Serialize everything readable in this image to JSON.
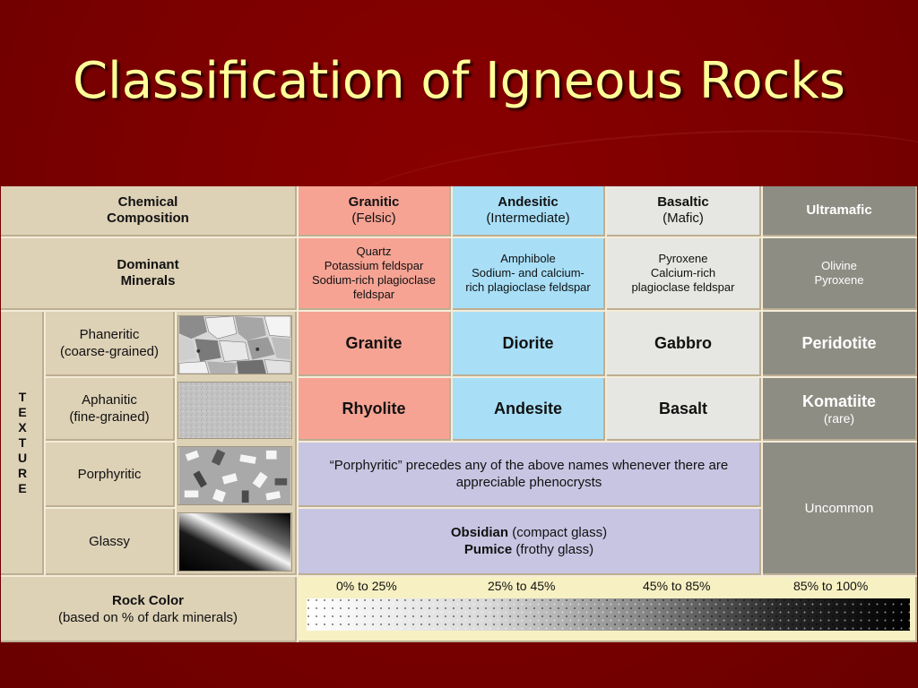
{
  "title": "Classification of Igneous Rocks",
  "header": {
    "chemical_composition": "Chemical\nComposition",
    "granitic": "Granitic",
    "granitic_sub": "(Felsic)",
    "andesitic": "Andesitic",
    "andesitic_sub": "(Intermediate)",
    "basaltic": "Basaltic",
    "basaltic_sub": "(Mafic)",
    "ultramafic": "Ultramafic"
  },
  "minerals": {
    "label": "Dominant\nMinerals",
    "granitic": [
      "Quartz",
      "Potassium feldspar",
      "Sodium-rich plagioclase feldspar"
    ],
    "andesitic": [
      "Amphibole",
      "Sodium- and calcium-rich plagioclase feldspar"
    ],
    "basaltic": [
      "Pyroxene",
      "Calcium-rich plagioclase feldspar"
    ],
    "ultramafic": [
      "Olivine",
      "Pyroxene"
    ]
  },
  "texture_label": "TEXTURE",
  "textures": {
    "phaneritic": "Phaneritic\n(coarse-grained)",
    "aphanitic": "Aphanitic\n(fine-grained)",
    "porphyritic": "Porphyritic",
    "glassy": "Glassy"
  },
  "rocks": {
    "granite": "Granite",
    "diorite": "Diorite",
    "gabbro": "Gabbro",
    "peridotite": "Peridotite",
    "rhyolite": "Rhyolite",
    "andesite": "Andesite",
    "basalt": "Basalt",
    "komatiite": "Komatiite",
    "komatiite_note": "(rare)"
  },
  "porphyritic_note": "“Porphyritic” precedes any of the above names whenever there are appreciable phenocrysts",
  "uncommon": "Uncommon",
  "glassy": {
    "obsidian": "Obsidian",
    "obsidian_note": "(compact glass)",
    "pumice": "Pumice",
    "pumice_note": "(frothy glass)"
  },
  "rock_color": {
    "label": "Rock Color",
    "sub": "(based on % of dark minerals)",
    "ranges": [
      "0% to 25%",
      "25% to 45%",
      "45% to 85%",
      "85% to 100%"
    ]
  },
  "colors": {
    "background": "#7a0000",
    "title": "#ffff99",
    "felsic": "#f6a394",
    "intermediate": "#a8dff7",
    "mafic": "#e6e6e2",
    "ultramafic": "#8d8d83",
    "porphyritic_band": "#c7c5e2",
    "label_cell": "#ddd1b6"
  }
}
